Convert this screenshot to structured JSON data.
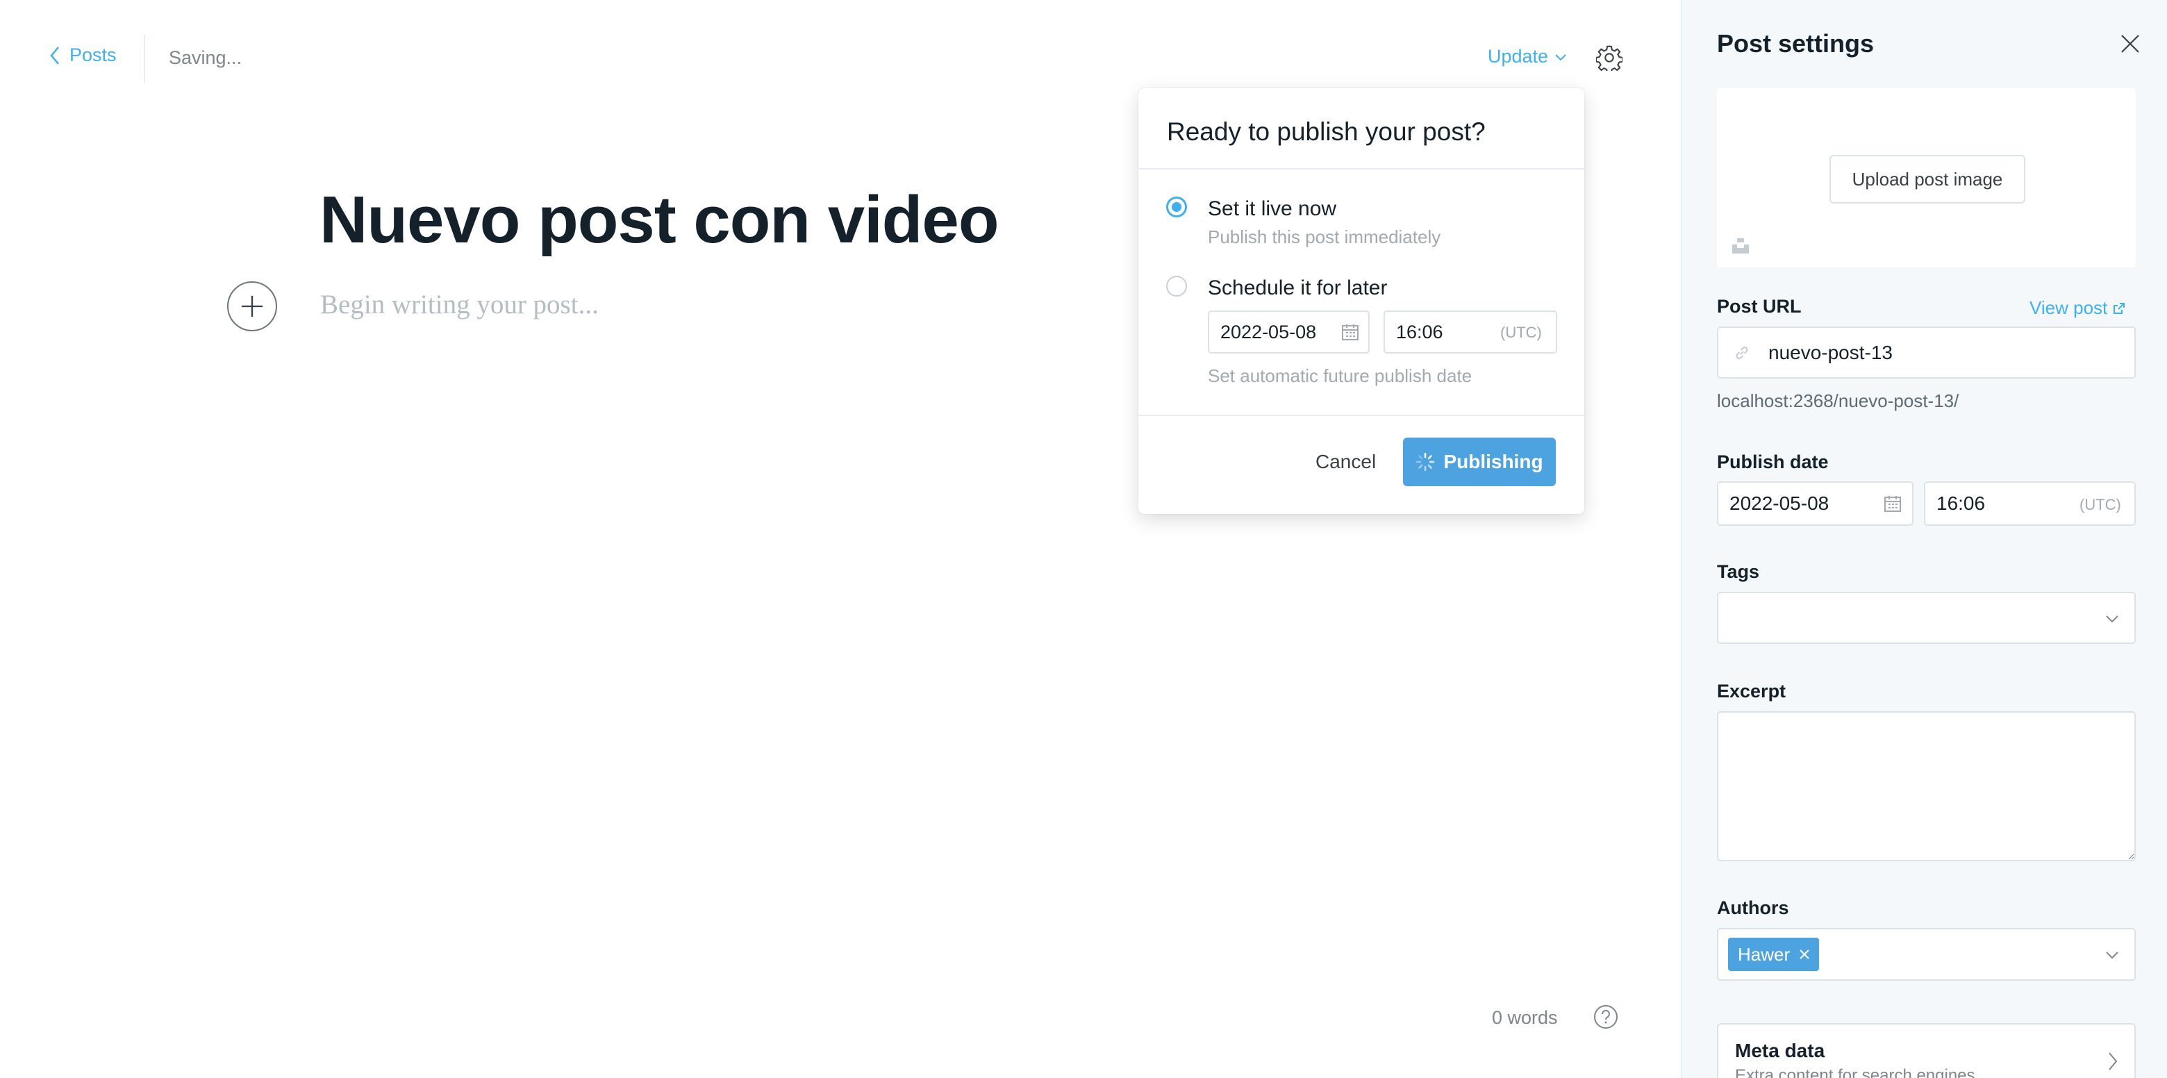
{
  "header": {
    "back_label": "Posts",
    "status": "Saving...",
    "update_label": "Update"
  },
  "editor": {
    "title": "Nuevo post con video",
    "body_placeholder": "Begin writing your post...",
    "word_count": "0 words"
  },
  "publish_popover": {
    "title": "Ready to publish your post?",
    "options": [
      {
        "label": "Set it live now",
        "description": "Publish this post immediately",
        "selected": true
      },
      {
        "label": "Schedule it for later",
        "description": "Set automatic future publish date",
        "selected": false
      }
    ],
    "schedule": {
      "date": "2022-05-08",
      "time": "16:06",
      "timezone": "(UTC)"
    },
    "cancel_label": "Cancel",
    "publish_label": "Publishing"
  },
  "sidebar": {
    "title": "Post settings",
    "upload_image_label": "Upload post image",
    "post_url": {
      "label": "Post URL",
      "view_post_label": "View post",
      "slug": "nuevo-post-13",
      "full_url": "localhost:2368/nuevo-post-13/"
    },
    "publish_date": {
      "label": "Publish date",
      "date": "2022-05-08",
      "time": "16:06",
      "timezone": "(UTC)"
    },
    "tags": {
      "label": "Tags",
      "value": ""
    },
    "excerpt": {
      "label": "Excerpt",
      "value": ""
    },
    "authors": {
      "label": "Authors",
      "items": [
        "Hawer"
      ]
    },
    "meta_data": {
      "title": "Meta data",
      "subtitle": "Extra content for search engines"
    }
  },
  "colors": {
    "accent": "#3eb0ef",
    "publish_button": "#4da3e0",
    "sidebar_bg": "#f4f8fb",
    "text": "#15212a"
  },
  "icons": [
    "chevron-left-icon",
    "chevron-down-icon",
    "gear-icon",
    "plus-icon",
    "help-icon",
    "calendar-icon",
    "spinner-icon",
    "close-icon",
    "link-icon",
    "external-link-icon",
    "unsplash-icon",
    "chevron-right-icon"
  ]
}
